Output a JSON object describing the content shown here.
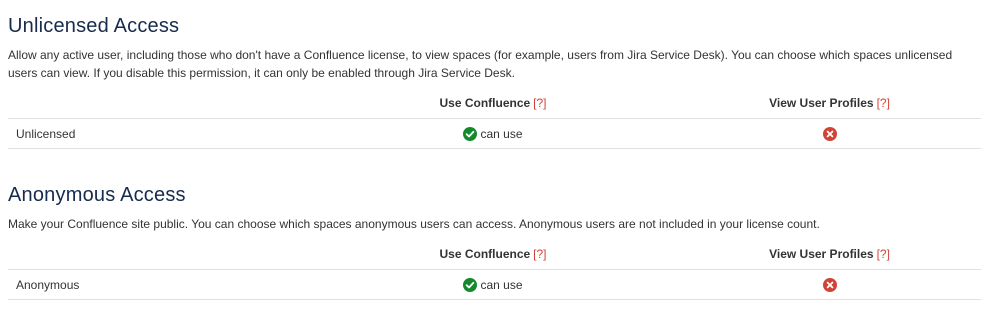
{
  "sections": [
    {
      "title": "Unlicensed Access",
      "description": "Allow any active user, including those who don't have a Confluence license, to view spaces (for example, users from Jira Service Desk). You can choose which spaces unlicensed users can view. If you disable this permission, it can only be enabled through Jira Service Desk.",
      "table": {
        "headers": {
          "use_confluence": "Use Confluence",
          "view_user_profiles": "View User Profiles",
          "help": "[?]"
        },
        "row": {
          "name": "Unlicensed",
          "use_status": "can use",
          "use_icon": "check-circle-icon",
          "view_icon": "cross-circle-icon"
        }
      }
    },
    {
      "title": "Anonymous Access",
      "description": "Make your Confluence site public. You can choose which spaces anonymous users can access. Anonymous users are not included in your license count.",
      "table": {
        "headers": {
          "use_confluence": "Use Confluence",
          "view_user_profiles": "View User Profiles",
          "help": "[?]"
        },
        "row": {
          "name": "Anonymous",
          "use_status": "can use",
          "use_icon": "check-circle-icon",
          "view_icon": "cross-circle-icon"
        }
      }
    }
  ],
  "colors": {
    "check": "#14892c",
    "cross": "#d04437",
    "help": "#d04437",
    "heading": "#172b4d"
  }
}
